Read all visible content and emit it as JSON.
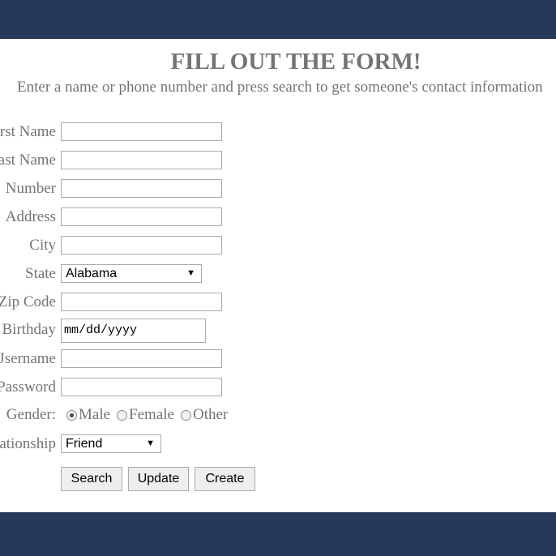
{
  "header": {
    "title": "FILL OUT THE FORM!",
    "subtitle": "Enter a name or phone number and press search to get someone's contact information"
  },
  "form": {
    "first_name_label": "rst Name",
    "last_name_label": "ast Name",
    "number_label": "Number",
    "address_label": "Address",
    "city_label": "City",
    "state_label": "State",
    "state_value": "Alabama",
    "zip_label": "Zip Code",
    "birthday_label": "Birthday",
    "birthday_placeholder": "mm/dd/yyyy",
    "username_label": "Jsername",
    "password_label": "Password",
    "gender_label": "Gender:",
    "gender_options": [
      {
        "label": "Male",
        "checked": true
      },
      {
        "label": "Female",
        "checked": false
      },
      {
        "label": "Other",
        "checked": false
      }
    ],
    "relationship_label": "ationship",
    "relationship_value": "Friend"
  },
  "buttons": {
    "search": "Search",
    "update": "Update",
    "create": "Create"
  },
  "colors": {
    "bar": "#26395a",
    "text": "#747474"
  }
}
